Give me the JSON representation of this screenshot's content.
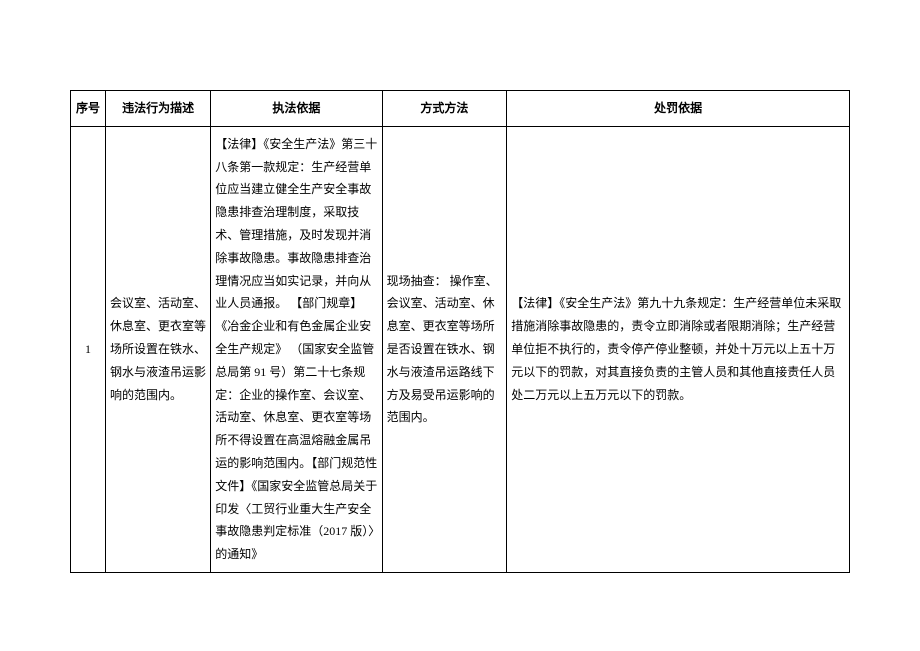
{
  "headers": {
    "col0": "序号",
    "col1": "违法行为描述",
    "col2": "执法依据",
    "col3": "方式方法",
    "col4": "处罚依据"
  },
  "row": {
    "seq": "1",
    "violation": "会议室、活动室、休息室、更衣室等场所设置在铁水、钢水与液渣吊运影响的范围内。",
    "legal_basis": "【法律】《安全生产法》第三十八条第一款规定：生产经营单位应当建立健全生产安全事故隐患排查治理制度，采取技术、管理措施，及时发现并消除事故隐患。事故隐患排查治理情况应当如实记录，并向从业人员通报。\n【部门规章】《冶金企业和有色金属企业安全生产规定》\n（国家安全监管总局第 91 号）第二十七条规定：企业的操作室、会议室、活动室、休息室、更衣室等场所不得设置在高温熔融金属吊运的影响范围内。【部门规范性文件】《国家安全监管总局关于印发〈工贸行业重大生产安全事故隐患判定标准（2017 版）〉的通知》",
    "method": "现场抽查：\n操作室、会议室、活动室、休息室、更衣室等场所是否设置在铁水、钢水与液渣吊运路线下方及易受吊运影响的范围内。",
    "penalty_basis": "【法律】《安全生产法》第九十九条规定：生产经营单位未采取措施消除事故隐患的，责令立即消除或者限期消除；生产经营单位拒不执行的，责令停产停业整顿，并处十万元以上五十万元以下的罚款，对其直接负责的主管人员和其他直接责任人员处二万元以上五万元以下的罚款。"
  }
}
